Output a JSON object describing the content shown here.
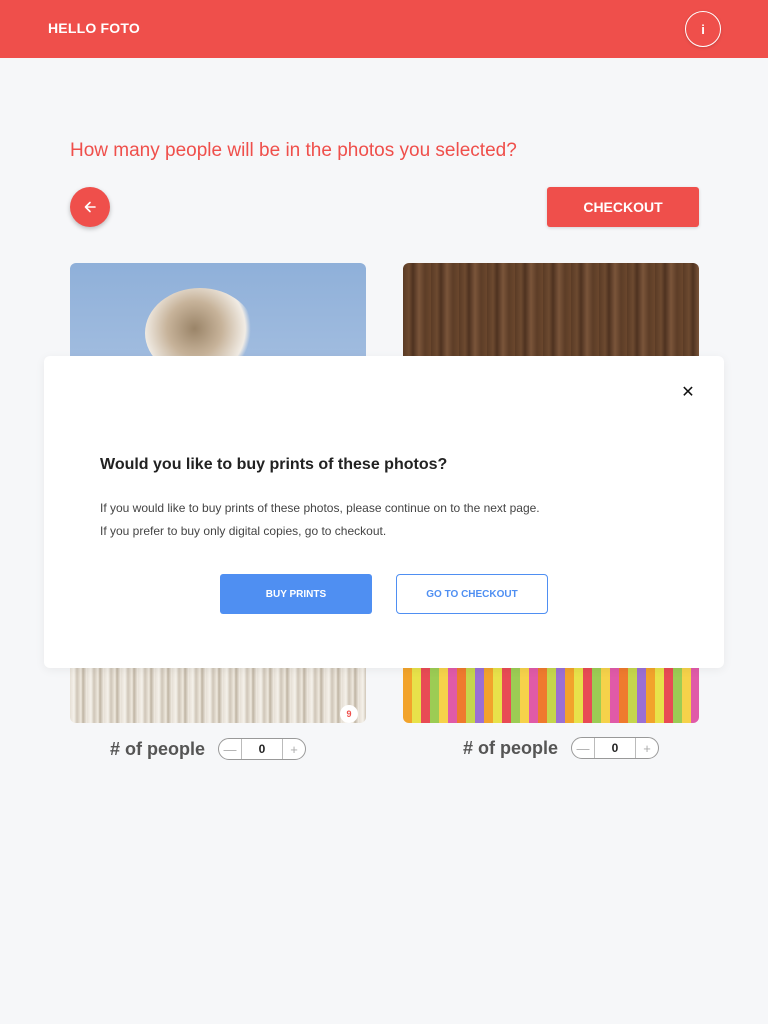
{
  "header": {
    "brand": "HELLO FOTO",
    "info_label": "i"
  },
  "main": {
    "question": "How many people will be in the photos you selected?",
    "checkout_label": "CHECKOUT"
  },
  "photos": [
    {
      "badge": "9",
      "people_label": "# of people",
      "count": "0",
      "minus": "—",
      "plus": "+"
    },
    {
      "people_label": "# of people",
      "count": "0",
      "minus": "—",
      "plus": "+"
    }
  ],
  "modal": {
    "close": "✕",
    "title": "Would you like to buy prints of these photos?",
    "line1": "If you would like to buy prints of these photos, please continue on to the next page.",
    "line2": "If you prefer to buy only digital copies, go to checkout.",
    "buy_prints": "BUY PRINTS",
    "go_to_checkout": "GO TO CHECKOUT"
  },
  "colors": {
    "brand_red": "#ef4f4b",
    "primary_blue": "#4f8ff2",
    "background": "#f6f7f9"
  }
}
